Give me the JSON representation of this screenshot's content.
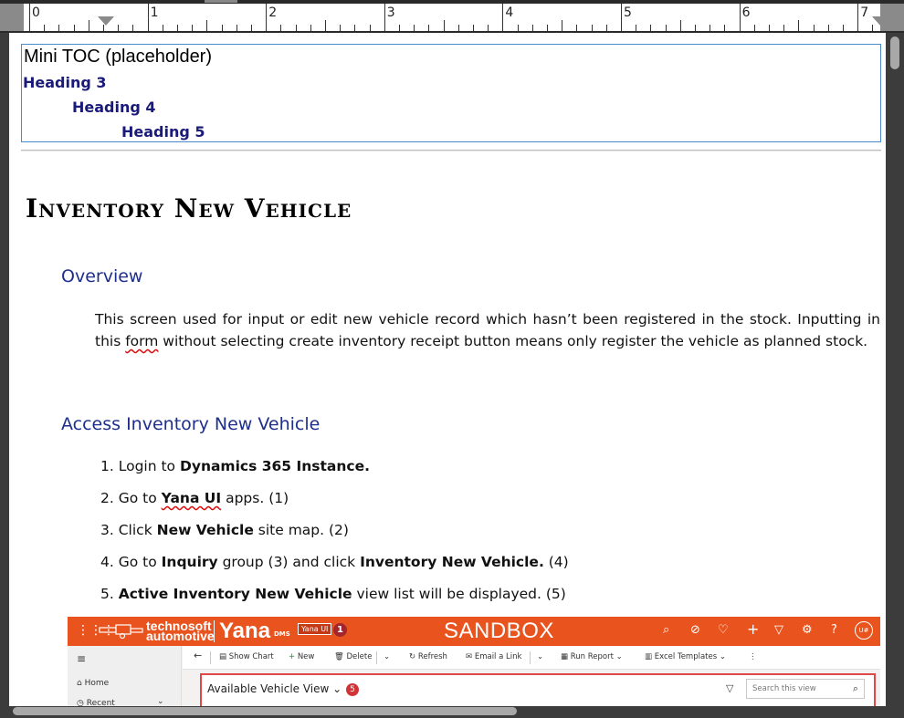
{
  "ruler": {
    "numbers": [
      "0",
      "1",
      "2",
      "3",
      "4",
      "5",
      "6",
      "7"
    ]
  },
  "toc": {
    "title": "Mini TOC (placeholder)",
    "items": [
      {
        "label": "Heading 3"
      },
      {
        "label": "Heading 4"
      },
      {
        "label": "Heading 5"
      }
    ]
  },
  "document": {
    "title": "Inventory New Vehicle",
    "overview_heading": "Overview",
    "overview_text_1": "This screen used for input or edit new vehicle record which hasn’t been registered in the stock. Inputting in this ",
    "overview_text_squiggle": "form",
    "overview_text_2": " without selecting create inventory receipt button means only register the  vehicle as planned stock.",
    "access_heading": "Access Inventory New Vehicle",
    "steps": [
      {
        "num": "1.",
        "pre": "Login to ",
        "bold": "Dynamics 365 Instance.",
        "post": ""
      },
      {
        "num": "2.",
        "pre": "Go to ",
        "bold": "Yana UI",
        "post": " apps. (1)"
      },
      {
        "num": "3.",
        "pre": "Click ",
        "bold": "New Vehicle",
        "post": " site map. (2)"
      },
      {
        "num": "4.",
        "pre": "Go to  ",
        "bold": "Inquiry",
        "post": " group (3) and click ",
        "bold2": "Inventory New Vehicle.",
        "post2": " (4)"
      },
      {
        "num": "5.",
        "pre": "",
        "bold": "Active Inventory New Vehicle",
        "post": " view list will be displayed. (5)"
      }
    ]
  },
  "screenshot": {
    "brand_line1": "technosoft",
    "brand_line2": "automotive",
    "app_name": "Yana",
    "app_suffix": "DMS",
    "app_badge": "Yana UI",
    "badge_1": "1",
    "env_name": "SANDBOX",
    "avatar": "U#",
    "nav": [
      {
        "label": "Home"
      },
      {
        "label": "Recent"
      }
    ],
    "commands": [
      {
        "label": "Show Chart"
      },
      {
        "label": "New"
      },
      {
        "label": "Delete"
      },
      {
        "label": "Refresh"
      },
      {
        "label": "Email a Link"
      },
      {
        "label": "Run Report"
      },
      {
        "label": "Excel Templates"
      }
    ],
    "view_title": "Available Vehicle View",
    "badge_5": "5",
    "search_placeholder": "Search this view"
  },
  "colors": {
    "header_orange": "#e9541e",
    "heading_blue": "#1d2f8a",
    "toc_blue": "#1a1a7a",
    "toc_border": "#4a8cc9"
  }
}
